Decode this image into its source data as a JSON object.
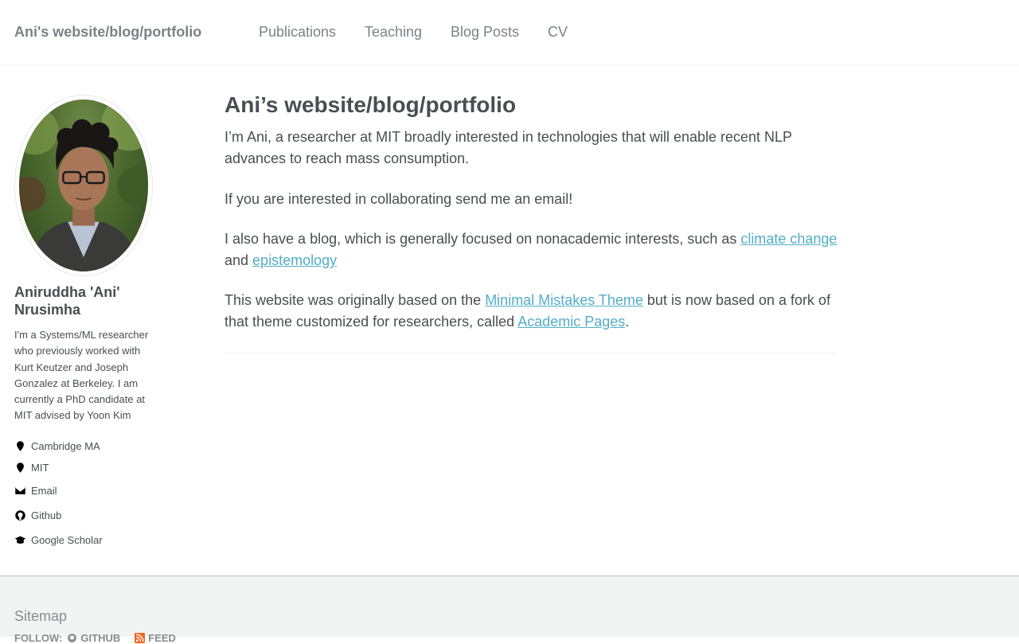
{
  "masthead": {
    "site_title": "Ani's website/blog/portfolio",
    "nav": [
      "Publications",
      "Teaching",
      "Blog Posts",
      "CV"
    ]
  },
  "sidebar": {
    "author_name": "Aniruddha 'Ani' Nrusimha",
    "bio": "I'm a Systems/ML researcher who previously worked with Kurt Keutzer and Joseph Gonzalez at Berkeley. I am currently a PhD candidate at MIT advised by Yoon Kim",
    "links": [
      {
        "icon": "location-pin-icon",
        "label": "Cambridge MA"
      },
      {
        "icon": "location-pin-icon",
        "label": "MIT"
      },
      {
        "icon": "envelope-icon",
        "label": "Email"
      },
      {
        "icon": "github-icon",
        "label": "Github"
      },
      {
        "icon": "graduation-cap-icon",
        "label": "Google Scholar"
      }
    ]
  },
  "main": {
    "title": "Ani’s website/blog/portfolio",
    "p1": "I’m Ani, a researcher at MIT broadly interested in technologies that will enable recent NLP advances to reach mass consumption.",
    "p2": "If you are interested in collaborating send me an email!",
    "p3_before": "I also have a blog, which is generally focused on nonacademic interests, such as ",
    "p3_link1": "climate change",
    "p3_mid": " and ",
    "p3_link2": "epistemology",
    "p4_before": "This website was originally based on the ",
    "p4_link1": "Minimal Mistakes Theme",
    "p4_mid": " but is now based on a fork of that theme customized for researchers, called ",
    "p4_link2": "Academic Pages",
    "p4_after": "."
  },
  "footer": {
    "sitemap": "Sitemap",
    "follow_label": "Follow:",
    "github": "GitHub",
    "feed": "Feed"
  },
  "colors": {
    "link": "#52adc8",
    "text": "#494e52",
    "muted": "#7a8288",
    "footer_bg": "#f2f3f3"
  }
}
